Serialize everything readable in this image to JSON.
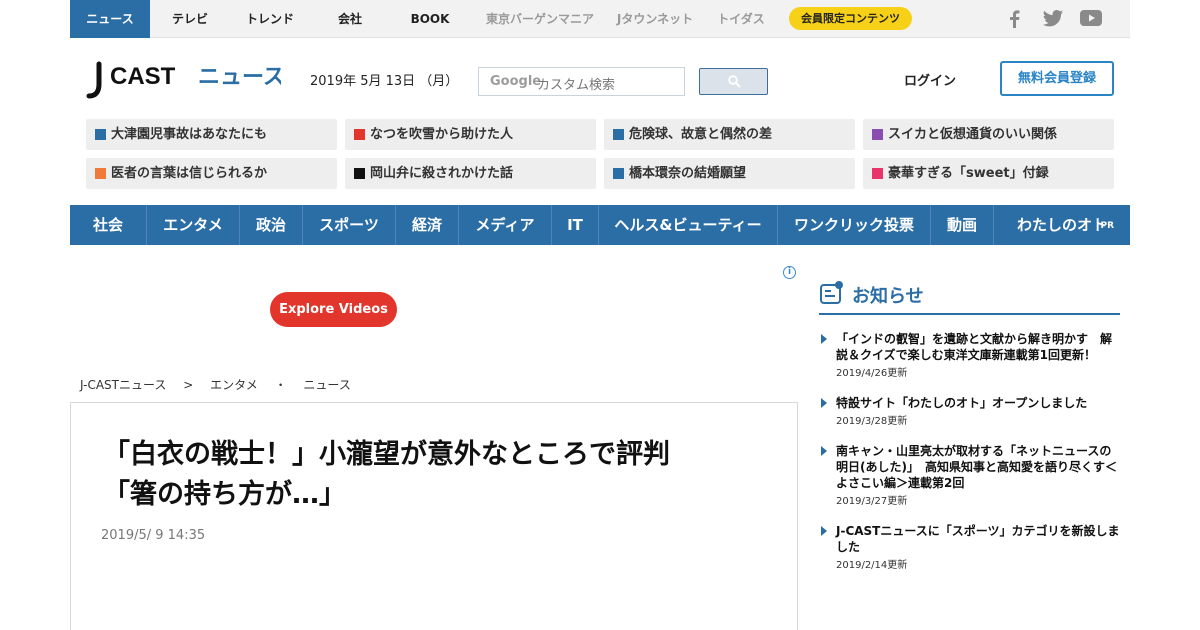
{
  "topnav": {
    "items": [
      "ニュース",
      "テレビ",
      "トレンド",
      "会社",
      "BOOK",
      "東京バーゲンマニア",
      "Jタウンネット",
      "トイダス"
    ],
    "members": "会員限定コンテンツ",
    "social": [
      "facebook-icon",
      "twitter-icon",
      "youtube-icon"
    ]
  },
  "header": {
    "logo_text": "J-CASTニュース",
    "logo_main": "CAST",
    "logo_kana": "ニュース",
    "date": "2019年 5月 13日 （月）",
    "search_brand": "Google",
    "search_placeholder": "カスタム検索",
    "login": "ログイン",
    "signup": "無料会員登録"
  },
  "trending": [
    {
      "label": "大津園児事故はあなたにも",
      "color": "#2a6ea5"
    },
    {
      "label": "なつを吹雪から助けた人",
      "color": "#e2352b"
    },
    {
      "label": "危険球、故意と偶然の差",
      "color": "#2a6ea5"
    },
    {
      "label": "スイカと仮想通貨のいい関係",
      "color": "#8a4db0"
    },
    {
      "label": "医者の言葉は信じられるか",
      "color": "#f07a3a"
    },
    {
      "label": "岡山弁に殺されかけた話",
      "color": "#111111"
    },
    {
      "label": "橋本環奈の結婚願望",
      "color": "#2a6ea5"
    },
    {
      "label": "豪華すぎる「sweet」付録",
      "color": "#e8336b"
    }
  ],
  "categories": [
    "社会",
    "エンタメ",
    "政治",
    "スポーツ",
    "経済",
    "メディア",
    "IT",
    "ヘルス&ビューティー",
    "ワンクリック投票",
    "動画",
    "わたしのオト"
  ],
  "category_pr": "PR",
  "ad": {
    "info": "i",
    "explore": "Explore Videos"
  },
  "breadcrumb": [
    "J-CASTニュース",
    ">",
    "エンタメ",
    "・",
    "ニュース"
  ],
  "article": {
    "title_line1": "「白衣の戦士！」小瀧望が意外なところで評判",
    "title_line2": "「箸の持ち方が…」",
    "timestamp": "2019/5/ 9 14:35"
  },
  "notices": {
    "heading": "お知らせ",
    "items": [
      {
        "title": "「インドの叡智」を遺跡と文献から解き明かす　解説＆クイズで楽しむ東洋文庫新連載第1回更新！",
        "date": "2019/4/26更新"
      },
      {
        "title": "特設サイト「わたしのオト」オープンしました",
        "date": "2019/3/28更新"
      },
      {
        "title": "南キャン・山里亮太が取材する「ネットニュースの明日(あした)」　高知県知事と高知愛を語り尽くす＜よさこい編＞連載第2回",
        "date": "2019/3/27更新"
      },
      {
        "title": "J-CASTニュースに「スポーツ」カテゴリを新設しました",
        "date": "2019/2/14更新"
      }
    ]
  },
  "colors": {
    "brand": "#2a6ea5",
    "accent": "#f7d117",
    "explore": "#e2352b"
  }
}
